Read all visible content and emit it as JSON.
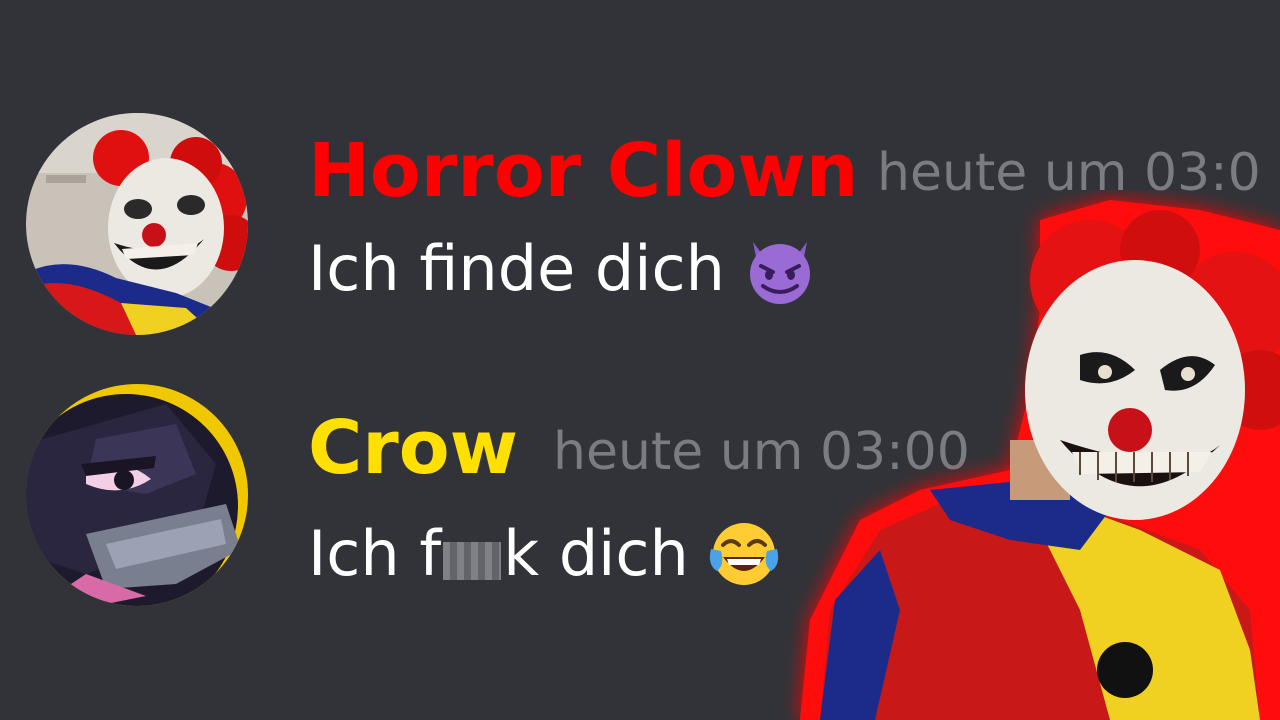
{
  "messages": [
    {
      "username": "Horror Clown",
      "username_color": "#ff0000",
      "timestamp": "heute um 03:0",
      "text": "Ich finde dich",
      "emoji_icon": "smiling-imp-icon",
      "avatar_icon": "horror-clown-avatar"
    },
    {
      "username": "Crow",
      "username_color": "#ffe000",
      "timestamp": "heute um 03:00",
      "text_before": "Ich f",
      "text_after": "k dich",
      "emoji_icon": "tears-of-joy-icon",
      "avatar_icon": "crow-avatar"
    }
  ],
  "colors": {
    "background": "#313338",
    "timestamp": "#7a7c82",
    "message_text": "#ffffff",
    "clown_glow": "#ff0000"
  }
}
